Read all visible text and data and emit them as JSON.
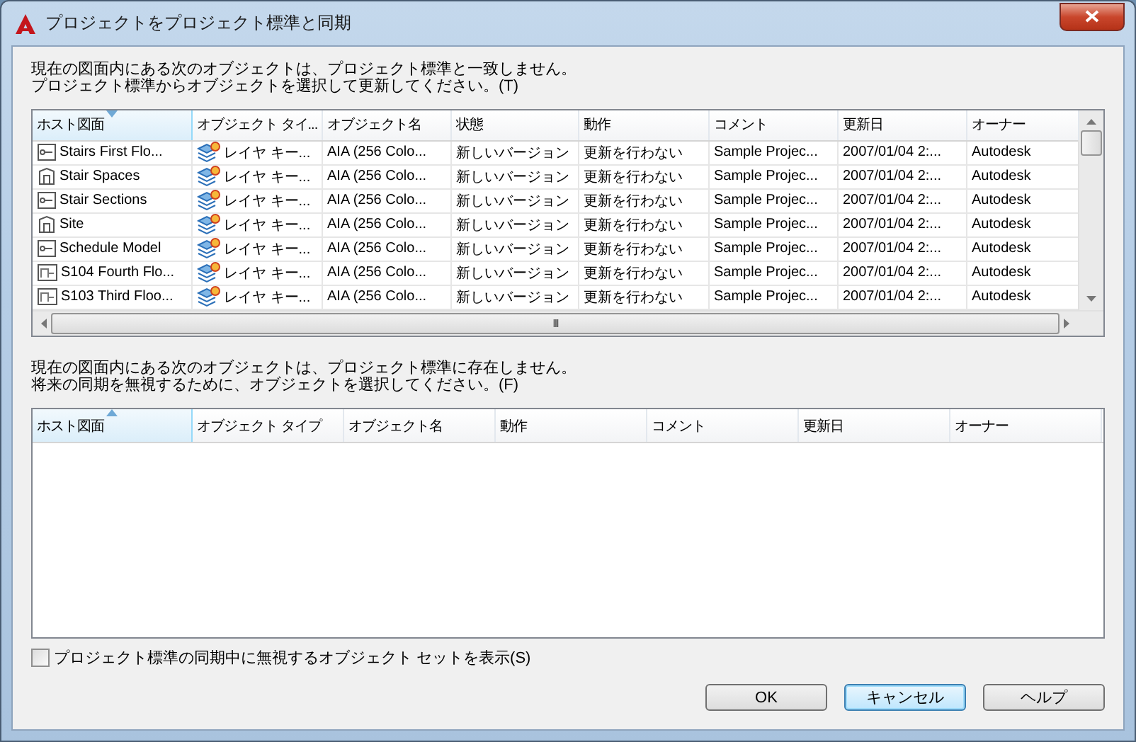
{
  "window": {
    "title": "プロジェクトをプロジェクト標準と同期"
  },
  "mismatch_section": {
    "description_lines": [
      "現在の図面内にある次のオブジェクトは、プロジェクト標準と一致しません。",
      "プロジェクト標準からオブジェクトを選択して更新してください。(T)"
    ],
    "table": {
      "columns": [
        {
          "label": "ホスト図面",
          "sort_ascending": false
        },
        {
          "label": "オブジェクト タイ..."
        },
        {
          "label": "オブジェクト名"
        },
        {
          "label": "状態"
        },
        {
          "label": "動作"
        },
        {
          "label": "コメント"
        },
        {
          "label": "更新日"
        },
        {
          "label": "オーナー"
        }
      ],
      "rows": [
        {
          "kind": "view",
          "cells": [
            "Stairs First Flo...",
            "レイヤ キー...",
            "AIA (256 Colo...",
            "新しいバージョン",
            "更新を行わない",
            "Sample Projec...",
            "2007/01/04 2:...",
            "Autodesk"
          ]
        },
        {
          "kind": "building",
          "cells": [
            "Stair Spaces",
            "レイヤ キー...",
            "AIA (256 Colo...",
            "新しいバージョン",
            "更新を行わない",
            "Sample Projec...",
            "2007/01/04 2:...",
            "Autodesk"
          ]
        },
        {
          "kind": "view",
          "cells": [
            "Stair Sections",
            "レイヤ キー...",
            "AIA (256 Colo...",
            "新しいバージョン",
            "更新を行わない",
            "Sample Projec...",
            "2007/01/04 2:...",
            "Autodesk"
          ]
        },
        {
          "kind": "building",
          "cells": [
            "Site",
            "レイヤ キー...",
            "AIA (256 Colo...",
            "新しいバージョン",
            "更新を行わない",
            "Sample Projec...",
            "2007/01/04 2:...",
            "Autodesk"
          ]
        },
        {
          "kind": "view",
          "cells": [
            "Schedule Model",
            "レイヤ キー...",
            "AIA (256 Colo...",
            "新しいバージョン",
            "更新を行わない",
            "Sample Projec...",
            "2007/01/04 2:...",
            "Autodesk"
          ]
        },
        {
          "kind": "sheet",
          "cells": [
            "S104 Fourth Flo...",
            "レイヤ キー...",
            "AIA (256 Colo...",
            "新しいバージョン",
            "更新を行わない",
            "Sample Projec...",
            "2007/01/04 2:...",
            "Autodesk"
          ]
        },
        {
          "kind": "sheet",
          "cells": [
            "S103 Third Floo...",
            "レイヤ キー...",
            "AIA (256 Colo...",
            "新しいバージョン",
            "更新を行わない",
            "Sample Projec...",
            "2007/01/04 2:...",
            "Autodesk"
          ]
        }
      ],
      "scroll_grip": "III"
    }
  },
  "missing_section": {
    "description_lines": [
      "現在の図面内にある次のオブジェクトは、プロジェクト標準に存在しません。",
      "将来の同期を無視するために、オブジェクトを選択してください。(F)"
    ],
    "table": {
      "columns": [
        {
          "label": "ホスト図面",
          "sort_ascending": true
        },
        {
          "label": "オブジェクト タイプ"
        },
        {
          "label": "オブジェクト名"
        },
        {
          "label": "動作"
        },
        {
          "label": "コメント"
        },
        {
          "label": "更新日"
        },
        {
          "label": "オーナー"
        }
      ]
    }
  },
  "show_ignored": {
    "label": "プロジェクト標準の同期中に無視するオブジェクト セットを表示(S)",
    "checked": false
  },
  "buttons": [
    {
      "label": "OK",
      "default": false
    },
    {
      "label": "キャンセル",
      "default": true
    },
    {
      "label": "ヘルプ",
      "default": false
    }
  ]
}
